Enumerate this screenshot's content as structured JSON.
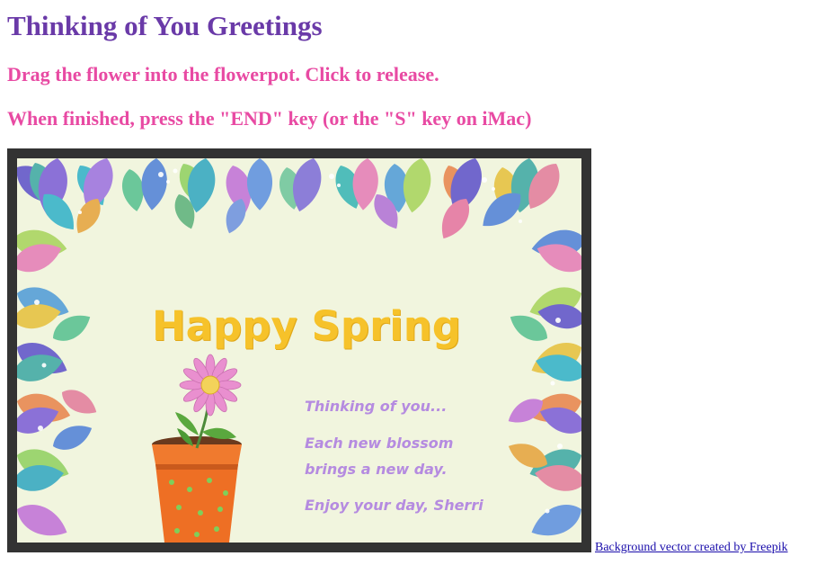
{
  "page": {
    "title": "Thinking of You Greetings",
    "instruction_1": "Drag the flower into the flowerpot. Click to release.",
    "instruction_2": "When finished, press the \"END\" key (or the \"S\" key on iMac)"
  },
  "card": {
    "heading": "Happy Spring",
    "lines": [
      "Thinking of you...",
      "Each new blossom",
      "brings a new day.",
      "Enjoy your day, Sherri"
    ]
  },
  "footer": {
    "credit_link": "Background vector created by Freepik"
  },
  "colors": {
    "title": "#6a3aa8",
    "instructions": "#e84aa3",
    "heading": "#f6c22a",
    "message": "#b58be0",
    "frame": "#333333",
    "card_background": "#f1f5de",
    "flowerpot": "#f07a2e",
    "flower_petals": "#e98fcf"
  }
}
